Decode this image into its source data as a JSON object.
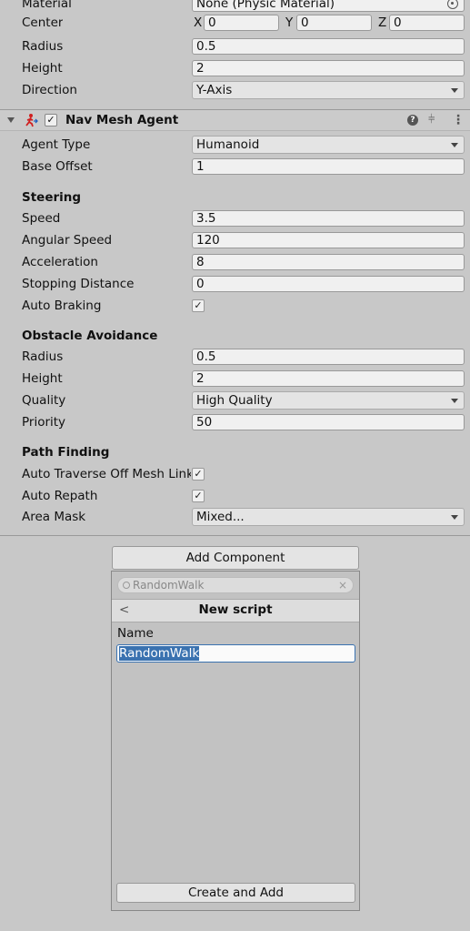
{
  "collider": {
    "material_label": "Material",
    "material_value": "None (Physic Material)",
    "center_label": "Center",
    "center_x_label": "X",
    "center_x": "0",
    "center_y_label": "Y",
    "center_y": "0",
    "center_z_label": "Z",
    "center_z": "0",
    "radius_label": "Radius",
    "radius": "0.5",
    "height_label": "Height",
    "height": "2",
    "direction_label": "Direction",
    "direction": "Y-Axis"
  },
  "nav_mesh_agent": {
    "title": "Nav Mesh Agent",
    "enabled": "✓",
    "agent_type_label": "Agent Type",
    "agent_type": "Humanoid",
    "base_offset_label": "Base Offset",
    "base_offset": "1",
    "steering": {
      "header": "Steering",
      "speed_label": "Speed",
      "speed": "3.5",
      "angular_speed_label": "Angular Speed",
      "angular_speed": "120",
      "acceleration_label": "Acceleration",
      "acceleration": "8",
      "stopping_distance_label": "Stopping Distance",
      "stopping_distance": "0",
      "auto_braking_label": "Auto Braking",
      "auto_braking": "✓"
    },
    "obstacle_avoidance": {
      "header": "Obstacle Avoidance",
      "radius_label": "Radius",
      "radius": "0.5",
      "height_label": "Height",
      "height": "2",
      "quality_label": "Quality",
      "quality": "High Quality",
      "priority_label": "Priority",
      "priority": "50"
    },
    "path_finding": {
      "header": "Path Finding",
      "auto_traverse_label": "Auto Traverse Off Mesh Link",
      "auto_traverse": "✓",
      "auto_repath_label": "Auto Repath",
      "auto_repath": "✓",
      "area_mask_label": "Area Mask",
      "area_mask": "Mixed..."
    }
  },
  "add_component": {
    "button_label": "Add Component",
    "search_value": "RandomWalk",
    "popup_title": "New script",
    "back_glyph": "<",
    "name_label": "Name",
    "name_value": "RandomWalk",
    "create_button_label": "Create and Add"
  },
  "icons": {
    "help": "help-icon",
    "presets": "presets-icon",
    "menu": "kebab-menu-icon",
    "nav_agent": "nav-mesh-agent-icon"
  }
}
